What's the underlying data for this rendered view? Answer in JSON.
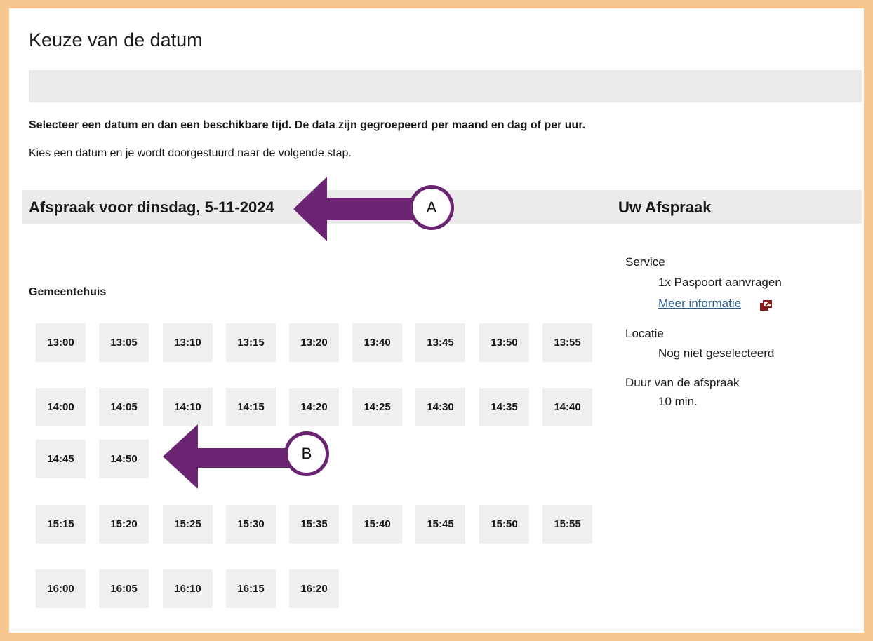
{
  "page": {
    "title": "Keuze van de datum",
    "intro_bold": "Selecteer een datum en dan een beschikbare tijd. De data zijn gegroepeerd per maand en dag of per uur.",
    "intro_text": "Kies een datum en je wordt doorgestuurd naar de volgende stap.",
    "date_heading": "Afspraak voor dinsdag, 5-11-2024",
    "location": "Gemeentehuis"
  },
  "slots": {
    "row1": [
      "13:00",
      "13:05",
      "13:10",
      "13:15",
      "13:20",
      "13:40",
      "13:45",
      "13:50",
      "13:55"
    ],
    "row2": [
      "14:00",
      "14:05",
      "14:10",
      "14:15",
      "14:20",
      "14:25",
      "14:30",
      "14:35",
      "14:40"
    ],
    "row3": [
      "14:45",
      "14:50"
    ],
    "row4": [
      "15:15",
      "15:20",
      "15:25",
      "15:30",
      "15:35",
      "15:40",
      "15:45",
      "15:50",
      "15:55"
    ],
    "row5": [
      "16:00",
      "16:05",
      "16:10",
      "16:15",
      "16:20"
    ]
  },
  "summary": {
    "heading": "Uw Afspraak",
    "service_label": "Service",
    "service_value": "1x Paspoort aanvragen",
    "more_info": "Meer informatie",
    "location_label": "Locatie",
    "location_value": "Nog niet geselecteerd",
    "duration_label": "Duur van de afspraak",
    "duration_value": "10 min."
  },
  "annotations": {
    "a_label": "A",
    "b_label": "B",
    "arrow_color": "#6b2471",
    "frame_color": "#f5c68e"
  },
  "icons": {
    "external_link": "external-link-icon"
  }
}
